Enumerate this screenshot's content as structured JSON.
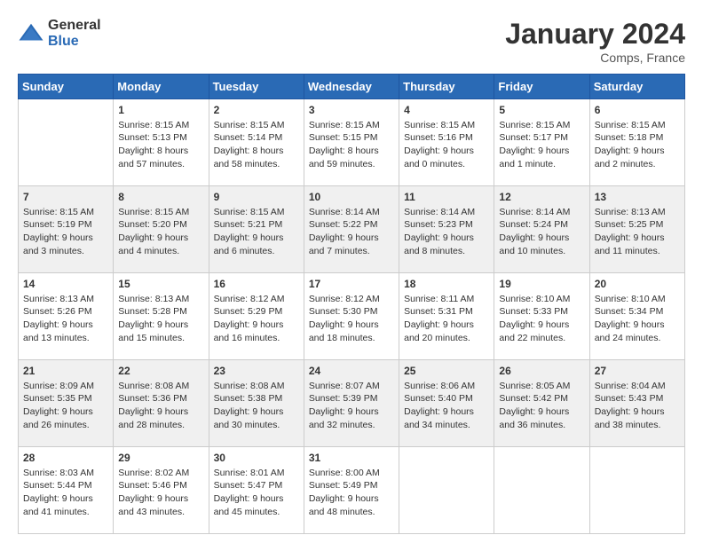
{
  "header": {
    "logo_general": "General",
    "logo_blue": "Blue",
    "month_title": "January 2024",
    "location": "Comps, France"
  },
  "weekdays": [
    "Sunday",
    "Monday",
    "Tuesday",
    "Wednesday",
    "Thursday",
    "Friday",
    "Saturday"
  ],
  "rows": [
    [
      {
        "day": "",
        "content": ""
      },
      {
        "day": "1",
        "content": "Sunrise: 8:15 AM\nSunset: 5:13 PM\nDaylight: 8 hours\nand 57 minutes."
      },
      {
        "day": "2",
        "content": "Sunrise: 8:15 AM\nSunset: 5:14 PM\nDaylight: 8 hours\nand 58 minutes."
      },
      {
        "day": "3",
        "content": "Sunrise: 8:15 AM\nSunset: 5:15 PM\nDaylight: 8 hours\nand 59 minutes."
      },
      {
        "day": "4",
        "content": "Sunrise: 8:15 AM\nSunset: 5:16 PM\nDaylight: 9 hours\nand 0 minutes."
      },
      {
        "day": "5",
        "content": "Sunrise: 8:15 AM\nSunset: 5:17 PM\nDaylight: 9 hours\nand 1 minute."
      },
      {
        "day": "6",
        "content": "Sunrise: 8:15 AM\nSunset: 5:18 PM\nDaylight: 9 hours\nand 2 minutes."
      }
    ],
    [
      {
        "day": "7",
        "content": "Sunrise: 8:15 AM\nSunset: 5:19 PM\nDaylight: 9 hours\nand 3 minutes."
      },
      {
        "day": "8",
        "content": "Sunrise: 8:15 AM\nSunset: 5:20 PM\nDaylight: 9 hours\nand 4 minutes."
      },
      {
        "day": "9",
        "content": "Sunrise: 8:15 AM\nSunset: 5:21 PM\nDaylight: 9 hours\nand 6 minutes."
      },
      {
        "day": "10",
        "content": "Sunrise: 8:14 AM\nSunset: 5:22 PM\nDaylight: 9 hours\nand 7 minutes."
      },
      {
        "day": "11",
        "content": "Sunrise: 8:14 AM\nSunset: 5:23 PM\nDaylight: 9 hours\nand 8 minutes."
      },
      {
        "day": "12",
        "content": "Sunrise: 8:14 AM\nSunset: 5:24 PM\nDaylight: 9 hours\nand 10 minutes."
      },
      {
        "day": "13",
        "content": "Sunrise: 8:13 AM\nSunset: 5:25 PM\nDaylight: 9 hours\nand 11 minutes."
      }
    ],
    [
      {
        "day": "14",
        "content": "Sunrise: 8:13 AM\nSunset: 5:26 PM\nDaylight: 9 hours\nand 13 minutes."
      },
      {
        "day": "15",
        "content": "Sunrise: 8:13 AM\nSunset: 5:28 PM\nDaylight: 9 hours\nand 15 minutes."
      },
      {
        "day": "16",
        "content": "Sunrise: 8:12 AM\nSunset: 5:29 PM\nDaylight: 9 hours\nand 16 minutes."
      },
      {
        "day": "17",
        "content": "Sunrise: 8:12 AM\nSunset: 5:30 PM\nDaylight: 9 hours\nand 18 minutes."
      },
      {
        "day": "18",
        "content": "Sunrise: 8:11 AM\nSunset: 5:31 PM\nDaylight: 9 hours\nand 20 minutes."
      },
      {
        "day": "19",
        "content": "Sunrise: 8:10 AM\nSunset: 5:33 PM\nDaylight: 9 hours\nand 22 minutes."
      },
      {
        "day": "20",
        "content": "Sunrise: 8:10 AM\nSunset: 5:34 PM\nDaylight: 9 hours\nand 24 minutes."
      }
    ],
    [
      {
        "day": "21",
        "content": "Sunrise: 8:09 AM\nSunset: 5:35 PM\nDaylight: 9 hours\nand 26 minutes."
      },
      {
        "day": "22",
        "content": "Sunrise: 8:08 AM\nSunset: 5:36 PM\nDaylight: 9 hours\nand 28 minutes."
      },
      {
        "day": "23",
        "content": "Sunrise: 8:08 AM\nSunset: 5:38 PM\nDaylight: 9 hours\nand 30 minutes."
      },
      {
        "day": "24",
        "content": "Sunrise: 8:07 AM\nSunset: 5:39 PM\nDaylight: 9 hours\nand 32 minutes."
      },
      {
        "day": "25",
        "content": "Sunrise: 8:06 AM\nSunset: 5:40 PM\nDaylight: 9 hours\nand 34 minutes."
      },
      {
        "day": "26",
        "content": "Sunrise: 8:05 AM\nSunset: 5:42 PM\nDaylight: 9 hours\nand 36 minutes."
      },
      {
        "day": "27",
        "content": "Sunrise: 8:04 AM\nSunset: 5:43 PM\nDaylight: 9 hours\nand 38 minutes."
      }
    ],
    [
      {
        "day": "28",
        "content": "Sunrise: 8:03 AM\nSunset: 5:44 PM\nDaylight: 9 hours\nand 41 minutes."
      },
      {
        "day": "29",
        "content": "Sunrise: 8:02 AM\nSunset: 5:46 PM\nDaylight: 9 hours\nand 43 minutes."
      },
      {
        "day": "30",
        "content": "Sunrise: 8:01 AM\nSunset: 5:47 PM\nDaylight: 9 hours\nand 45 minutes."
      },
      {
        "day": "31",
        "content": "Sunrise: 8:00 AM\nSunset: 5:49 PM\nDaylight: 9 hours\nand 48 minutes."
      },
      {
        "day": "",
        "content": ""
      },
      {
        "day": "",
        "content": ""
      },
      {
        "day": "",
        "content": ""
      }
    ]
  ]
}
